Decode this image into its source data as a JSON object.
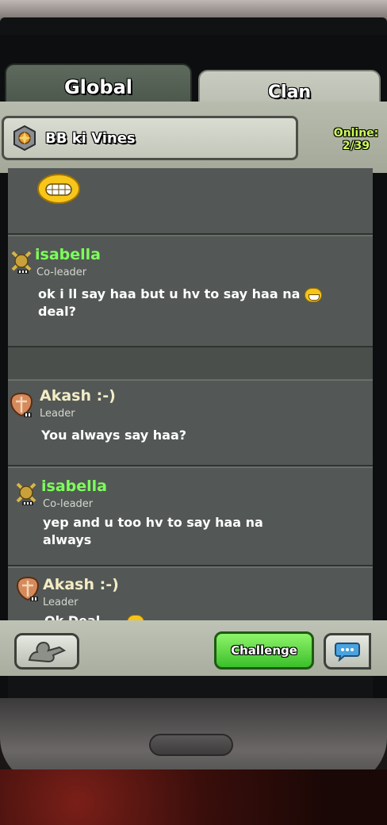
{
  "tabs": [
    {
      "label": "Global",
      "active": false
    },
    {
      "label": "Clan",
      "active": true
    }
  ],
  "clan": {
    "name": "BB ki Vines",
    "online_label": "Online:",
    "online_count": "2/39"
  },
  "messages": [
    {
      "sender": "isabella",
      "role": "Co-leader",
      "text_line1": "ok i ll say haa but u hv to say haa na",
      "text_line2": "deal?",
      "name_color": "#7dff5a",
      "icon": "co-leader-crossed-swords-icon"
    },
    {
      "sender": "Akash :-)",
      "role": "Leader",
      "text_line1": "You always say haa?",
      "text_line2": "",
      "name_color": "#f3ecc5",
      "icon": "leader-shield-icon"
    },
    {
      "sender": "isabella",
      "role": "Co-leader",
      "text_line1": "yep and u too hv to say haa na",
      "text_line2": "always",
      "name_color": "#7dff5a",
      "icon": "co-leader-crossed-swords-icon"
    },
    {
      "sender": "Akash :-)",
      "role": "Leader",
      "text_line1": "Ok Deal",
      "text_line2": "",
      "name_color": "#f3ecc5",
      "icon": "leader-shield-icon"
    }
  ],
  "buttons": {
    "challenge_label": "Challenge"
  },
  "colors": {
    "chat_bg": "#4a4f4c",
    "co_leader_name": "#7dff5a",
    "leader_name": "#f3ecc5",
    "challenge_green": "#3bbf2a"
  }
}
